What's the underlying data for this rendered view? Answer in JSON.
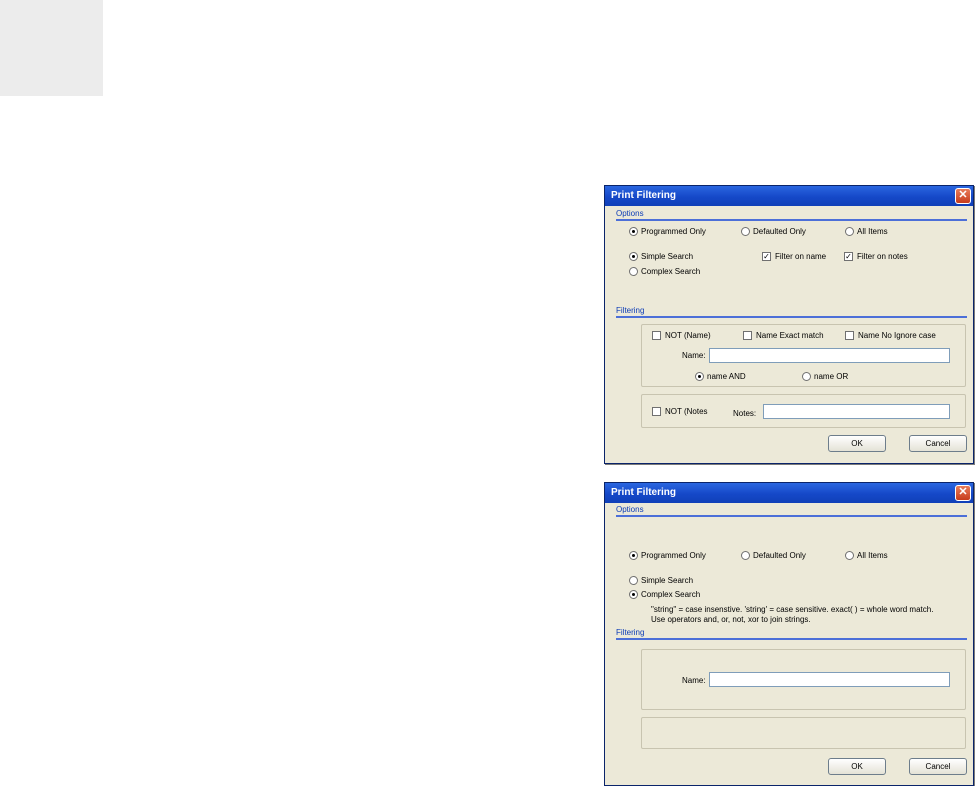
{
  "dialog1": {
    "title": "Print Filtering",
    "close_glyph": "✕",
    "options_section": "Options",
    "radio_programmed": "Programmed Only",
    "radio_defaulted": "Defaulted Only",
    "radio_all": "All Items",
    "radio_simple": "Simple Search",
    "radio_complex": "Complex Search",
    "check_filter_name": "Filter on name",
    "check_filter_notes": "Filter on notes",
    "filtering_section": "Filtering",
    "check_not_name": "NOT (Name)",
    "check_exact_match": "Name Exact match",
    "check_no_ignore_case": "Name No Ignore case",
    "name_label": "Name:",
    "name_value": "",
    "radio_name_and": "name AND",
    "radio_name_or": "name OR",
    "check_not_notes": "NOT (Notes",
    "notes_label": "Notes:",
    "notes_value": "",
    "ok": "OK",
    "cancel": "Cancel",
    "check_mark": "✓"
  },
  "dialog2": {
    "title": "Print Filtering",
    "close_glyph": "✕",
    "options_section": "Options",
    "radio_programmed": "Programmed Only",
    "radio_defaulted": "Defaulted Only",
    "radio_all": "All Items",
    "radio_simple": "Simple Search",
    "radio_complex": "Complex Search",
    "help_line1": "\"string\" = case insenstive. 'string' = case sensitive. exact( ) = whole word match.",
    "help_line2": "Use operators and, or, not, xor to join strings.",
    "filtering_section": "Filtering",
    "name_label": "Name:",
    "name_value": "",
    "ok": "OK",
    "cancel": "Cancel"
  }
}
